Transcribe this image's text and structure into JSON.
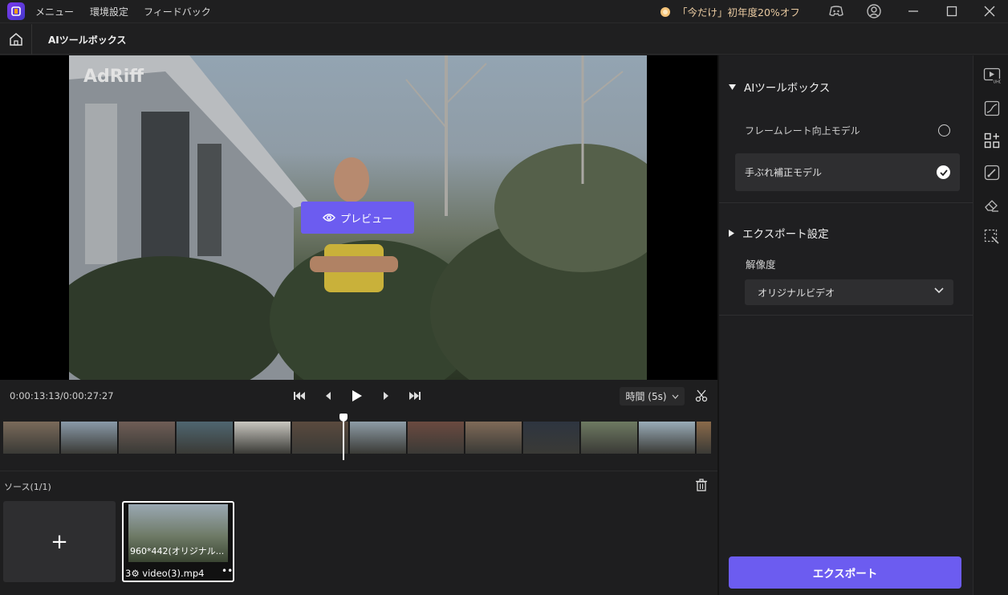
{
  "titlebar": {
    "menu": [
      "メニュー",
      "環境設定",
      "フィードバック"
    ],
    "promo": "「今だけ」初年度20%オフ",
    "icons": [
      "discord-icon",
      "account-icon",
      "minimize-icon",
      "maximize-icon",
      "close-icon"
    ]
  },
  "subbar": {
    "title": "AIツールボックス"
  },
  "preview": {
    "watermark": "AdRiff",
    "button_label": "プレビュー"
  },
  "controls": {
    "timecode": "0:00:13:13/0:00:27:27",
    "duration_label": "時間 (5s)"
  },
  "filmstrip": {
    "frame_colors": [
      "#7a6a5a",
      "#8a9aa8",
      "#6f5d56",
      "#4f6670",
      "#c9c7c0",
      "#5a4a3e",
      "#8e9ca6",
      "#6b4a40",
      "#7f6a58",
      "#2e3540",
      "#6e7a62",
      "#9aacb8",
      "#8a6a4a"
    ]
  },
  "sources": {
    "label": "ソース(1/1)",
    "clip": {
      "resolution": "960*442(オリジナル...",
      "name": "3⚙ video(3).mp4",
      "more": "•••"
    },
    "add_symbol": "+"
  },
  "panel": {
    "ai_section": "AIツールボックス",
    "options": [
      {
        "label": "フレームレート向上モデル",
        "selected": false
      },
      {
        "label": "手ぶれ補正モデル",
        "selected": true
      }
    ],
    "export_section": "エクスポート設定",
    "resolution_label": "解像度",
    "resolution_value": "オリジナルビデオ",
    "export_button": "エクスポート"
  },
  "rail": {
    "icons": [
      "uhd-video-icon",
      "curve-icon",
      "add-widget-icon",
      "paint-icon",
      "eraser-icon",
      "select-magic-icon"
    ]
  },
  "colors": {
    "accent": "#6c5cf0",
    "background": "#1e1e1f",
    "panel": "#1f1f21"
  }
}
